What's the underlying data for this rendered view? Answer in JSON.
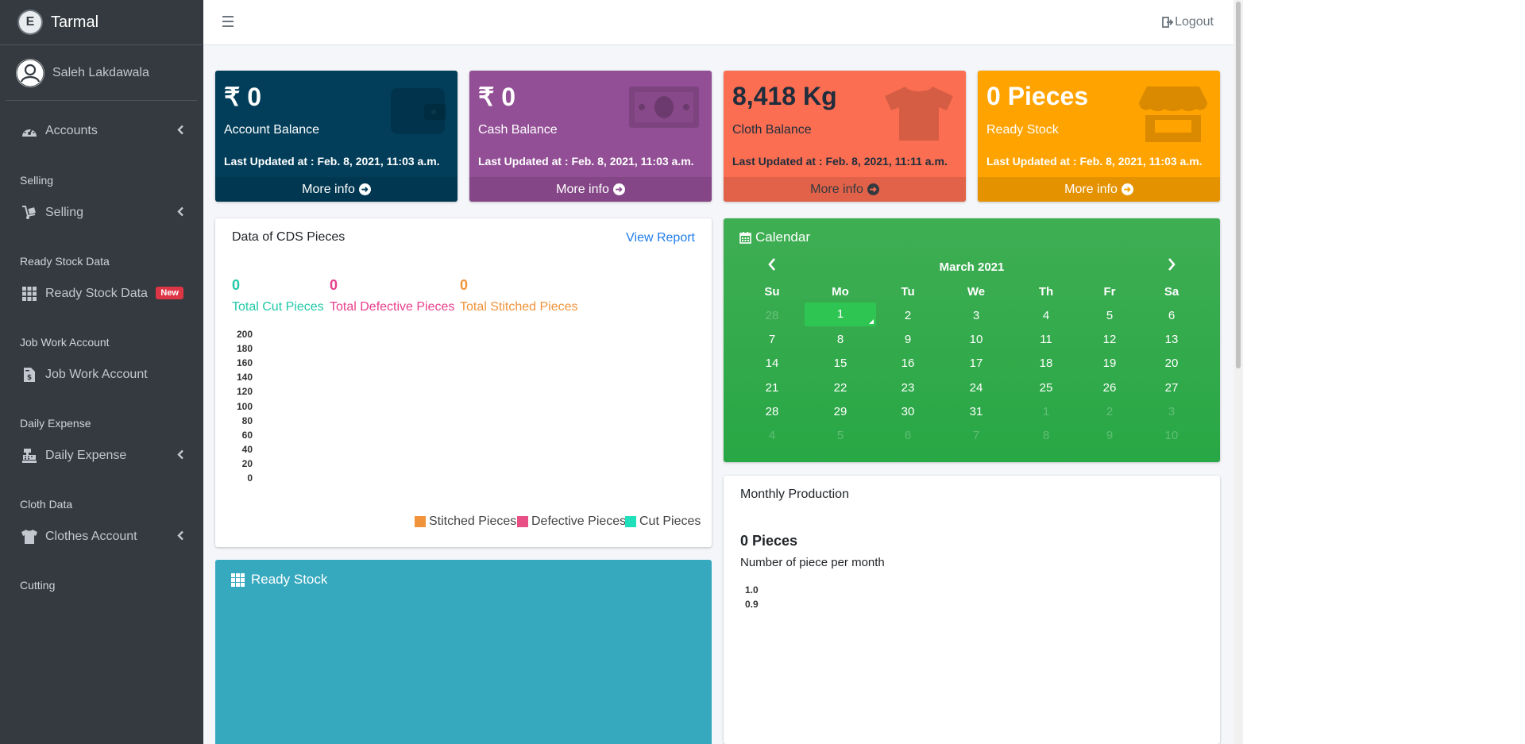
{
  "app": {
    "brand": "Tarmal",
    "brand_initial": "E"
  },
  "user": {
    "name": "Saleh Lakdawala"
  },
  "topbar": {
    "logout_label": "Logout"
  },
  "sidebar": {
    "items": [
      {
        "type": "item",
        "label": "Accounts",
        "icon": "dashboard-gauge-icon",
        "chevron": "‹"
      },
      {
        "type": "header",
        "label": "Selling"
      },
      {
        "type": "item",
        "label": "Selling",
        "icon": "dolly-cart-icon",
        "chevron": "‹"
      },
      {
        "type": "header",
        "label": "Ready Stock Data"
      },
      {
        "type": "item",
        "label": "Ready Stock Data",
        "icon": "grid-icon",
        "badge": "New"
      },
      {
        "type": "header",
        "label": "Job Work Account"
      },
      {
        "type": "item",
        "label": "Job Work Account",
        "icon": "invoice-file-icon"
      },
      {
        "type": "header",
        "label": "Daily Expense"
      },
      {
        "type": "item",
        "label": "Daily Expense",
        "icon": "cash-register-icon",
        "chevron": "‹"
      },
      {
        "type": "header",
        "label": "Cloth Data"
      },
      {
        "type": "item",
        "label": "Clothes Account",
        "icon": "tshirt-icon",
        "chevron": "‹"
      },
      {
        "type": "header",
        "label": "Cutting"
      }
    ]
  },
  "boxes": [
    {
      "value": "₹ 0",
      "label": "Account Balance",
      "updated": "Last Updated at : Feb. 8, 2021, 11:03 a.m.",
      "more": "More info",
      "color": "#023e5a",
      "icon": "wallet-icon"
    },
    {
      "value": "₹ 0",
      "label": "Cash Balance",
      "updated": "Last Updated at : Feb. 8, 2021, 11:03 a.m.",
      "more": "More info",
      "color": "#934f96",
      "icon": "money-bill-icon"
    },
    {
      "value": "8,418 Kg",
      "label": "Cloth Balance",
      "updated": "Last Updated at : Feb. 8, 2021, 11:11 a.m.",
      "more": "More info",
      "color": "#fb6e51",
      "icon": "tshirt-icon"
    },
    {
      "value": "0 Pieces",
      "label": "Ready Stock",
      "updated": "Last Updated at : Feb. 8, 2021, 11:03 a.m.",
      "more": "More info",
      "color": "#ffa300",
      "icon": "store-icon"
    }
  ],
  "cds": {
    "title": "Data of CDS Pieces",
    "view_report": "View Report",
    "stats": [
      {
        "value": "0",
        "label": "Total Cut Pieces",
        "color": "#20c9a6"
      },
      {
        "value": "0",
        "label": "Total Defective Pieces",
        "color": "#e83e8c"
      },
      {
        "value": "0",
        "label": "Total Stitched Pieces",
        "color": "#f0933a"
      }
    ],
    "chart_data": {
      "type": "bar",
      "categories": [],
      "series": [
        {
          "name": "Stitched Pieces",
          "values": []
        },
        {
          "name": "Defective Pieces",
          "values": []
        },
        {
          "name": "Cut Pieces",
          "values": []
        }
      ],
      "yticks": [
        "200",
        "180",
        "160",
        "140",
        "120",
        "100",
        "80",
        "60",
        "40",
        "20",
        "0"
      ],
      "ylim": [
        0,
        200
      ],
      "legend": "bottom-right",
      "colors": [
        "#f0933a",
        "#e84f84",
        "#20dfbb"
      ]
    }
  },
  "calendar": {
    "title": "Calendar",
    "month": "March 2021",
    "prev": "‹",
    "next": "›",
    "days_of_week": [
      "Su",
      "Mo",
      "Tu",
      "We",
      "Th",
      "Fr",
      "Sa"
    ],
    "weeks": [
      [
        "28",
        "1",
        "2",
        "3",
        "4",
        "5",
        "6"
      ],
      [
        "7",
        "8",
        "9",
        "10",
        "11",
        "12",
        "13"
      ],
      [
        "14",
        "15",
        "16",
        "17",
        "18",
        "19",
        "20"
      ],
      [
        "21",
        "22",
        "23",
        "24",
        "25",
        "26",
        "27"
      ],
      [
        "28",
        "29",
        "30",
        "31",
        "1",
        "2",
        "3"
      ],
      [
        "4",
        "5",
        "6",
        "7",
        "8",
        "9",
        "10"
      ]
    ],
    "selected": "1"
  },
  "monthly": {
    "title": "Monthly Production",
    "value": "0 Pieces",
    "subtitle": "Number of piece per month",
    "chart_data": {
      "type": "line",
      "yticks": [
        "1.0",
        "0.9"
      ]
    }
  },
  "ready_stock": {
    "title": "Ready Stock"
  }
}
